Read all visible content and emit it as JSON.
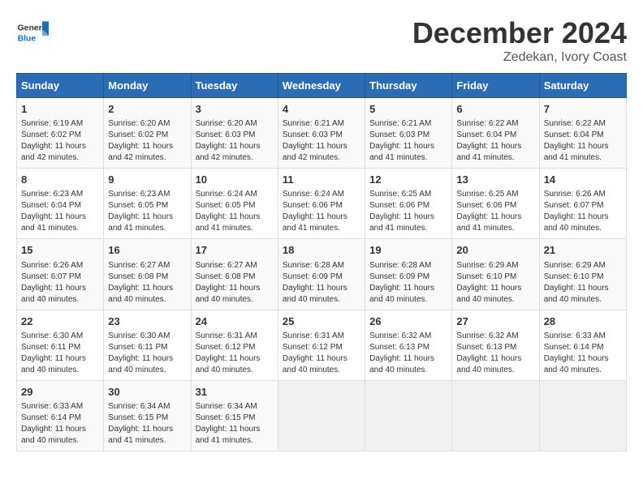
{
  "header": {
    "logo_line1": "General",
    "logo_line2": "Blue",
    "month_title": "December 2024",
    "location": "Zedekan, Ivory Coast"
  },
  "weekdays": [
    "Sunday",
    "Monday",
    "Tuesday",
    "Wednesday",
    "Thursday",
    "Friday",
    "Saturday"
  ],
  "weeks": [
    [
      {
        "day": "1",
        "info": "Sunrise: 6:19 AM\nSunset: 6:02 PM\nDaylight: 11 hours and 42 minutes."
      },
      {
        "day": "2",
        "info": "Sunrise: 6:20 AM\nSunset: 6:02 PM\nDaylight: 11 hours and 42 minutes."
      },
      {
        "day": "3",
        "info": "Sunrise: 6:20 AM\nSunset: 6:03 PM\nDaylight: 11 hours and 42 minutes."
      },
      {
        "day": "4",
        "info": "Sunrise: 6:21 AM\nSunset: 6:03 PM\nDaylight: 11 hours and 42 minutes."
      },
      {
        "day": "5",
        "info": "Sunrise: 6:21 AM\nSunset: 6:03 PM\nDaylight: 11 hours and 41 minutes."
      },
      {
        "day": "6",
        "info": "Sunrise: 6:22 AM\nSunset: 6:04 PM\nDaylight: 11 hours and 41 minutes."
      },
      {
        "day": "7",
        "info": "Sunrise: 6:22 AM\nSunset: 6:04 PM\nDaylight: 11 hours and 41 minutes."
      }
    ],
    [
      {
        "day": "8",
        "info": "Sunrise: 6:23 AM\nSunset: 6:04 PM\nDaylight: 11 hours and 41 minutes."
      },
      {
        "day": "9",
        "info": "Sunrise: 6:23 AM\nSunset: 6:05 PM\nDaylight: 11 hours and 41 minutes."
      },
      {
        "day": "10",
        "info": "Sunrise: 6:24 AM\nSunset: 6:05 PM\nDaylight: 11 hours and 41 minutes."
      },
      {
        "day": "11",
        "info": "Sunrise: 6:24 AM\nSunset: 6:06 PM\nDaylight: 11 hours and 41 minutes."
      },
      {
        "day": "12",
        "info": "Sunrise: 6:25 AM\nSunset: 6:06 PM\nDaylight: 11 hours and 41 minutes."
      },
      {
        "day": "13",
        "info": "Sunrise: 6:25 AM\nSunset: 6:06 PM\nDaylight: 11 hours and 41 minutes."
      },
      {
        "day": "14",
        "info": "Sunrise: 6:26 AM\nSunset: 6:07 PM\nDaylight: 11 hours and 40 minutes."
      }
    ],
    [
      {
        "day": "15",
        "info": "Sunrise: 6:26 AM\nSunset: 6:07 PM\nDaylight: 11 hours and 40 minutes."
      },
      {
        "day": "16",
        "info": "Sunrise: 6:27 AM\nSunset: 6:08 PM\nDaylight: 11 hours and 40 minutes."
      },
      {
        "day": "17",
        "info": "Sunrise: 6:27 AM\nSunset: 6:08 PM\nDaylight: 11 hours and 40 minutes."
      },
      {
        "day": "18",
        "info": "Sunrise: 6:28 AM\nSunset: 6:09 PM\nDaylight: 11 hours and 40 minutes."
      },
      {
        "day": "19",
        "info": "Sunrise: 6:28 AM\nSunset: 6:09 PM\nDaylight: 11 hours and 40 minutes."
      },
      {
        "day": "20",
        "info": "Sunrise: 6:29 AM\nSunset: 6:10 PM\nDaylight: 11 hours and 40 minutes."
      },
      {
        "day": "21",
        "info": "Sunrise: 6:29 AM\nSunset: 6:10 PM\nDaylight: 11 hours and 40 minutes."
      }
    ],
    [
      {
        "day": "22",
        "info": "Sunrise: 6:30 AM\nSunset: 6:11 PM\nDaylight: 11 hours and 40 minutes."
      },
      {
        "day": "23",
        "info": "Sunrise: 6:30 AM\nSunset: 6:11 PM\nDaylight: 11 hours and 40 minutes."
      },
      {
        "day": "24",
        "info": "Sunrise: 6:31 AM\nSunset: 6:12 PM\nDaylight: 11 hours and 40 minutes."
      },
      {
        "day": "25",
        "info": "Sunrise: 6:31 AM\nSunset: 6:12 PM\nDaylight: 11 hours and 40 minutes."
      },
      {
        "day": "26",
        "info": "Sunrise: 6:32 AM\nSunset: 6:13 PM\nDaylight: 11 hours and 40 minutes."
      },
      {
        "day": "27",
        "info": "Sunrise: 6:32 AM\nSunset: 6:13 PM\nDaylight: 11 hours and 40 minutes."
      },
      {
        "day": "28",
        "info": "Sunrise: 6:33 AM\nSunset: 6:14 PM\nDaylight: 11 hours and 40 minutes."
      }
    ],
    [
      {
        "day": "29",
        "info": "Sunrise: 6:33 AM\nSunset: 6:14 PM\nDaylight: 11 hours and 40 minutes."
      },
      {
        "day": "30",
        "info": "Sunrise: 6:34 AM\nSunset: 6:15 PM\nDaylight: 11 hours and 41 minutes."
      },
      {
        "day": "31",
        "info": "Sunrise: 6:34 AM\nSunset: 6:15 PM\nDaylight: 11 hours and 41 minutes."
      },
      {
        "day": "",
        "info": ""
      },
      {
        "day": "",
        "info": ""
      },
      {
        "day": "",
        "info": ""
      },
      {
        "day": "",
        "info": ""
      }
    ]
  ]
}
